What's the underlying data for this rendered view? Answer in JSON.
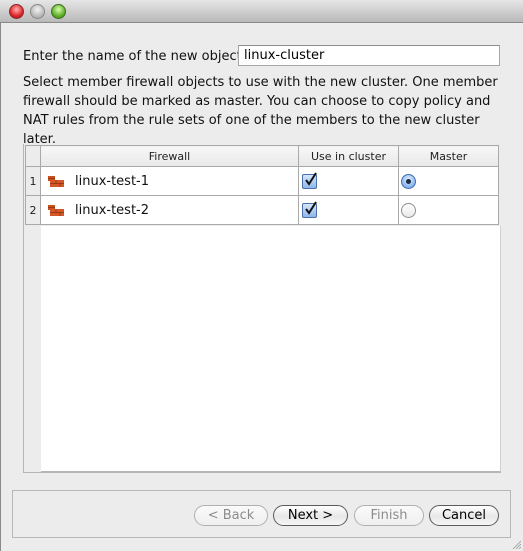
{
  "window": {
    "controls": [
      "close",
      "minimize",
      "zoom"
    ]
  },
  "form": {
    "name_label": "Enter the name of the new object",
    "name_value": "linux-cluster",
    "description": "Select member firewall objects to use with the new cluster. One member firewall should be marked as master. You can choose to copy policy and NAT rules from the rule sets of one of the members to the new cluster later."
  },
  "table": {
    "columns": [
      "Firewall",
      "Use in cluster",
      "Master"
    ],
    "rows": [
      {
        "num": "1",
        "firewall": "linux-test-1",
        "icon": "firewall-icon",
        "use_in_cluster": true,
        "master": true
      },
      {
        "num": "2",
        "firewall": "linux-test-2",
        "icon": "firewall-icon",
        "use_in_cluster": true,
        "master": false
      }
    ]
  },
  "buttons": {
    "back": "< Back",
    "next": "Next >",
    "finish": "Finish",
    "cancel": "Cancel"
  },
  "colors": {
    "window_bg": "#ececec",
    "firewall_icon": "#c8501e",
    "checkbox_accent": "#4b6fa8"
  }
}
